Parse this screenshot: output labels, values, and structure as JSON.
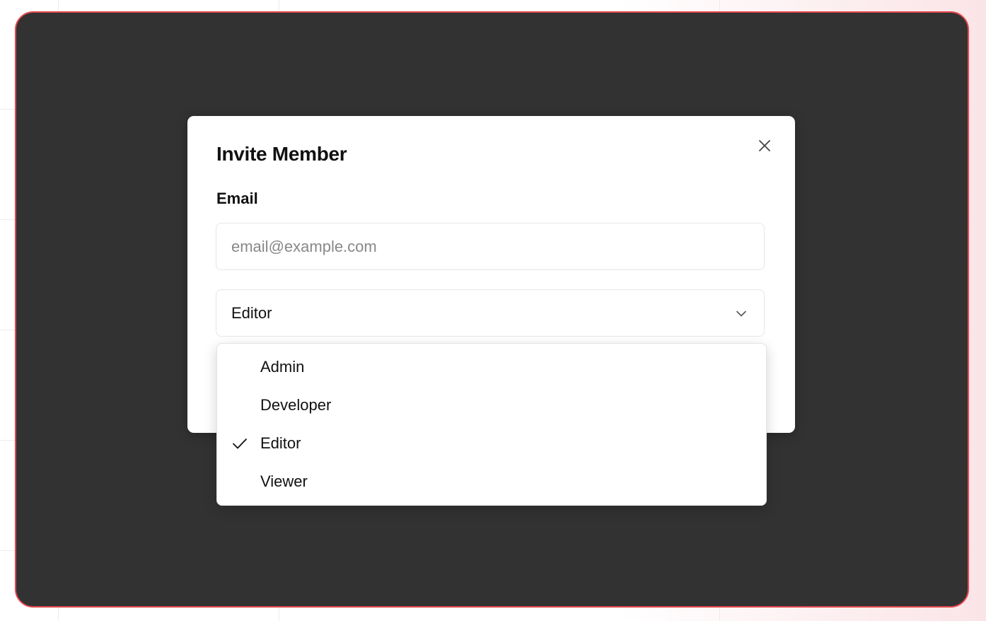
{
  "dialog": {
    "title": "Invite Member",
    "email_label": "Email",
    "email_value": "",
    "email_placeholder": "email@example.com",
    "close_icon": "close-icon"
  },
  "role_select": {
    "selected": "Editor",
    "icon": "chevron-down-icon",
    "options": [
      {
        "label": "Admin",
        "selected": false
      },
      {
        "label": "Developer",
        "selected": false
      },
      {
        "label": "Editor",
        "selected": true
      },
      {
        "label": "Viewer",
        "selected": false
      }
    ]
  },
  "colors": {
    "frame_border": "#e5484d",
    "overlay": "#323232",
    "text": "#111111"
  }
}
